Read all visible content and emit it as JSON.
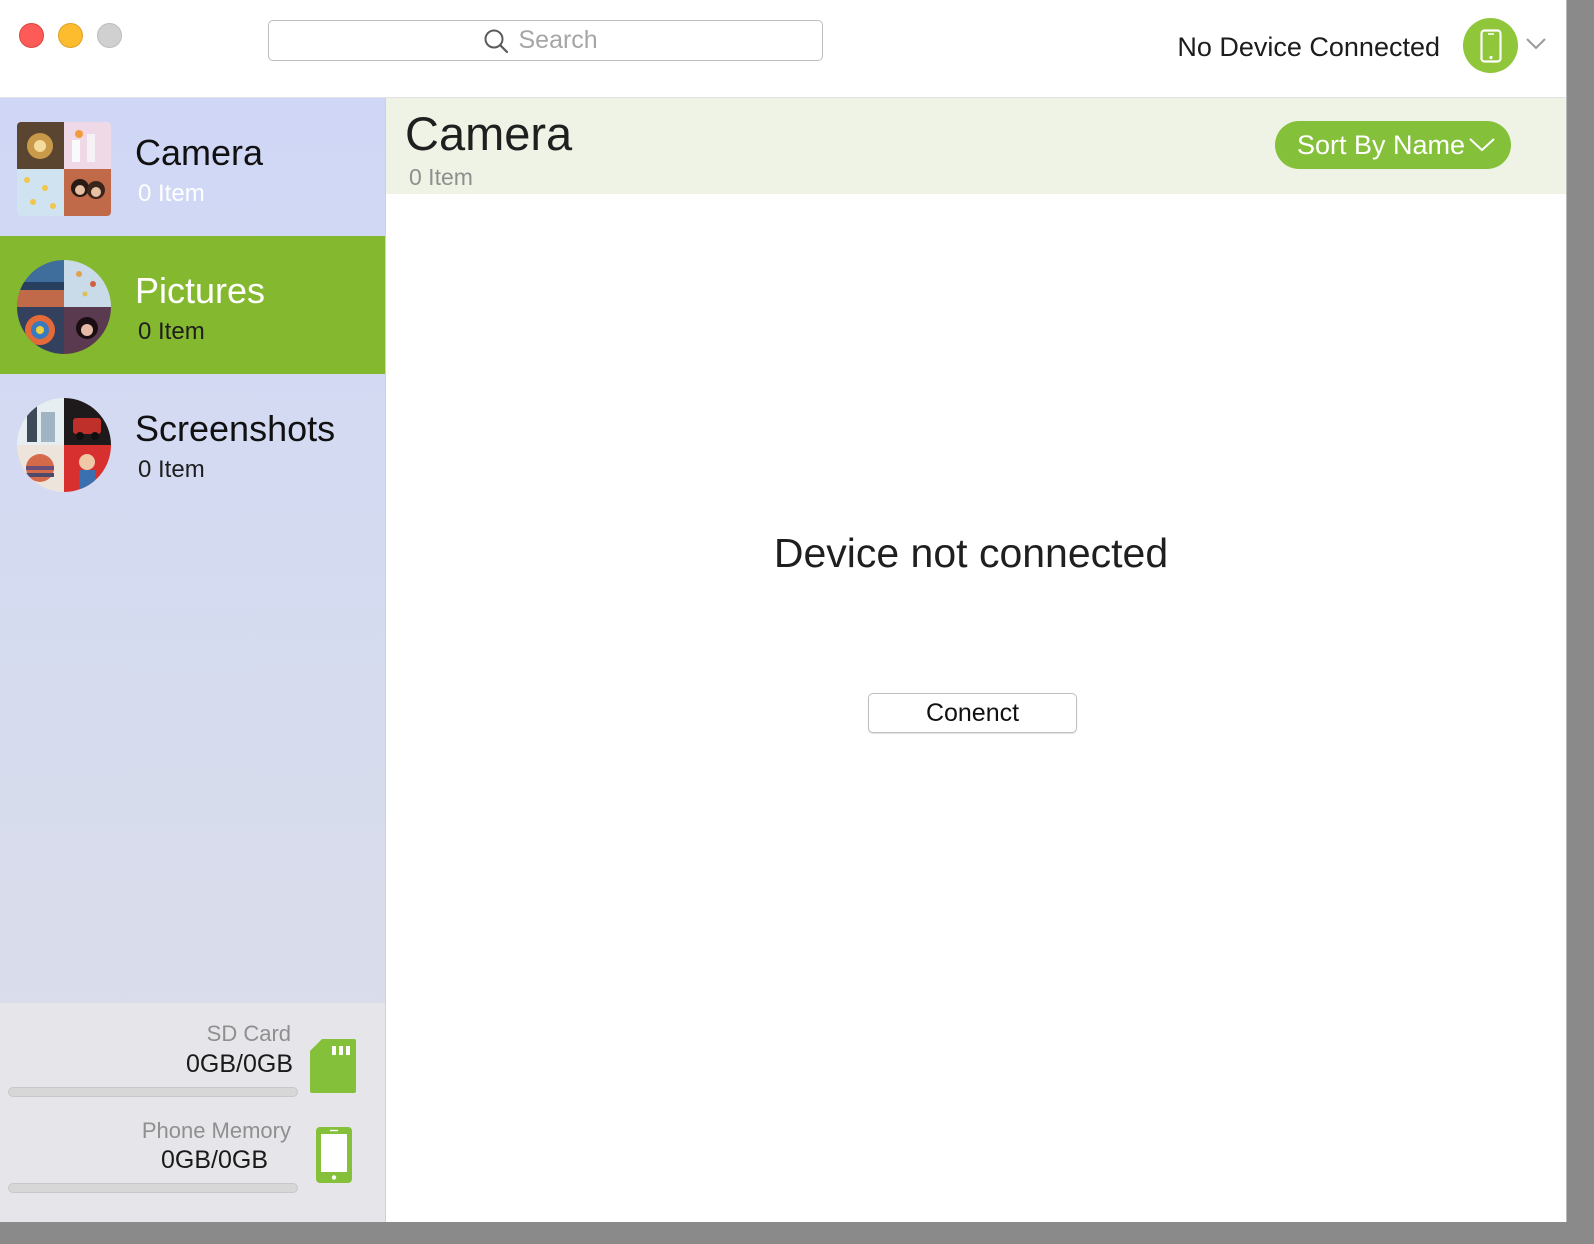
{
  "window": {
    "traffic_lights": [
      "close",
      "minimize",
      "maximize"
    ]
  },
  "search": {
    "placeholder": "Search",
    "value": ""
  },
  "device": {
    "status": "No Device Connected",
    "icon": "phone-icon",
    "accent": "#8fc63a"
  },
  "sidebar": {
    "albums": [
      {
        "name": "Camera",
        "count": "0 Item"
      },
      {
        "name": "Pictures",
        "count": "0 Item",
        "selected": true
      },
      {
        "name": "Screenshots",
        "count": "0 Item"
      }
    ],
    "storage": [
      {
        "label": "SD Card",
        "value": "0GB/0GB",
        "used_fraction": 0,
        "icon": "sd-card-icon"
      },
      {
        "label": "Phone Memory",
        "value": "0GB/0GB",
        "used_fraction": 0,
        "icon": "phone-icon"
      }
    ]
  },
  "main": {
    "title": "Camera",
    "count": "0 Item",
    "sort_label": "Sort By Name",
    "empty_message": "Device not connected",
    "connect_label": "Conenct"
  },
  "colors": {
    "accent_green": "#84b82e",
    "header_bg": "#eff3e5",
    "sidebar_bg": "#d0d7f6"
  }
}
